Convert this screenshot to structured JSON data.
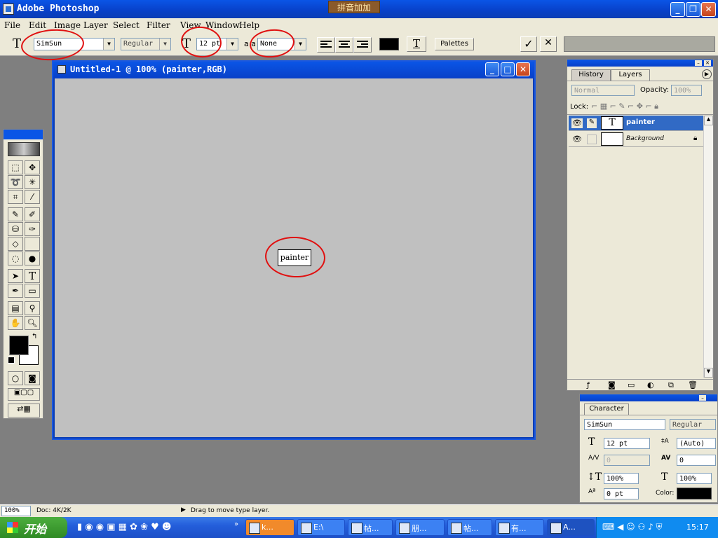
{
  "app": {
    "title": "Adobe Photoshop",
    "ime": "拼音加加"
  },
  "window_controls": {
    "minimize": "_",
    "restore": "❐",
    "close": "✕"
  },
  "menu": [
    "File",
    "Edit",
    "Image",
    "Layer",
    "Select",
    "Filter",
    "View",
    "Window",
    "Help"
  ],
  "options": {
    "tool_glyph": "T",
    "font_family": "SimSun",
    "font_style": "Regular",
    "size_glyph": "T",
    "font_size": "12 pt",
    "aa_glyph": "a a",
    "antialias": "None",
    "warp_glyph": "T",
    "palettes_label": "Palettes",
    "commit_glyph": "✓",
    "cancel_glyph": "✕",
    "text_color": "#000000"
  },
  "document": {
    "title": "Untitled-1 @ 100% (painter,RGB)",
    "text_layer_content": "painter"
  },
  "layers_panel": {
    "tabs": [
      "History",
      "Layers"
    ],
    "blend_mode": "Normal",
    "opacity_label": "Opacity:",
    "opacity_value": "100%",
    "lock_label": "Lock:",
    "layers": [
      {
        "name": "painter",
        "thumb": "T",
        "selected": true
      },
      {
        "name": "Background",
        "thumb": "",
        "selected": false
      }
    ]
  },
  "character_panel": {
    "tab": "Character",
    "font_family": "SimSun",
    "font_style": "Regular",
    "size": "12 pt",
    "leading": "(Auto)",
    "kerning": "0",
    "tracking": "0",
    "vscale": "100%",
    "hscale": "100%",
    "baseline": "0 pt",
    "color_label": "Color:",
    "color": "#000000"
  },
  "status": {
    "zoom": "100%",
    "doc": "Doc: 4K/2K",
    "hint": "Drag to move type layer."
  },
  "taskbar": {
    "start": "开始",
    "items": [
      "k...",
      "E:\\",
      "帖...",
      "朋...",
      "帖...",
      "有...",
      "A..."
    ],
    "clock": "15:17"
  }
}
